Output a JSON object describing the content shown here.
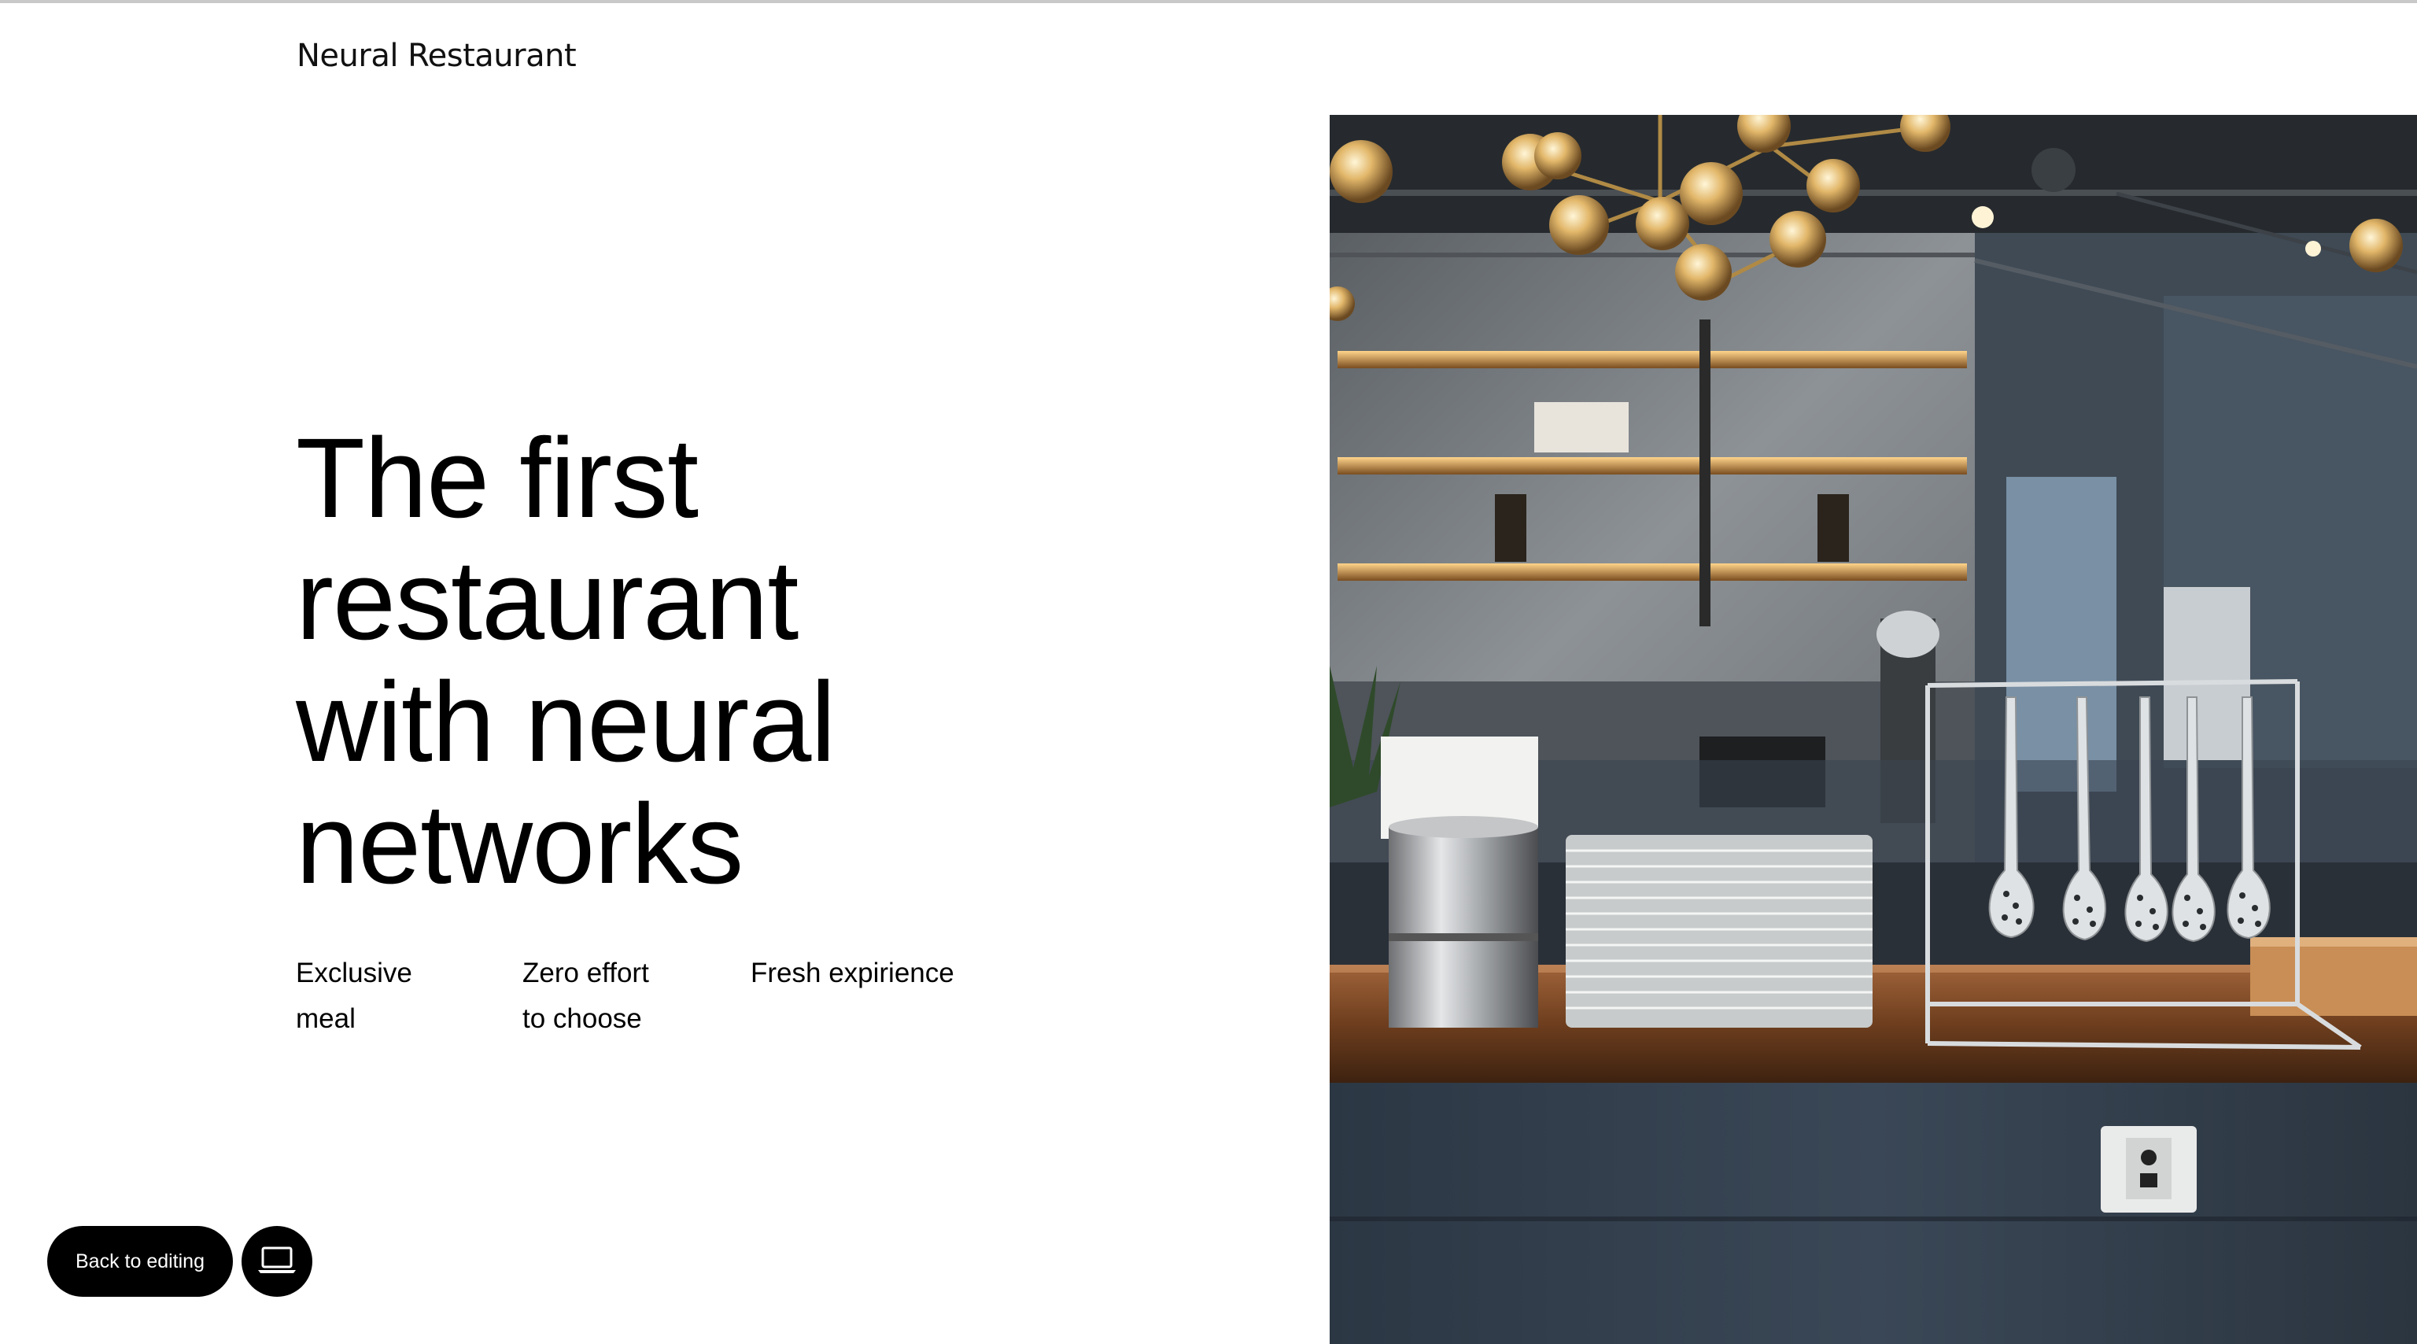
{
  "brand": {
    "name": "Neural Restaurant"
  },
  "hero": {
    "headline_lines": [
      "The first",
      "restaurant",
      "with neural",
      "networks"
    ]
  },
  "features": [
    {
      "lines": [
        "Exclusive",
        "meal"
      ]
    },
    {
      "lines": [
        "Zero effort",
        "to choose"
      ]
    },
    {
      "lines": [
        "Fresh expirience"
      ]
    }
  ],
  "image": {
    "icon": "restaurant-interior-photo"
  },
  "controls": {
    "back_label": "Back to editing",
    "device_icon": "laptop-icon"
  },
  "colors": {
    "button_bg": "#000000",
    "button_text": "#ffffff",
    "page_bg": "#ffffff"
  }
}
